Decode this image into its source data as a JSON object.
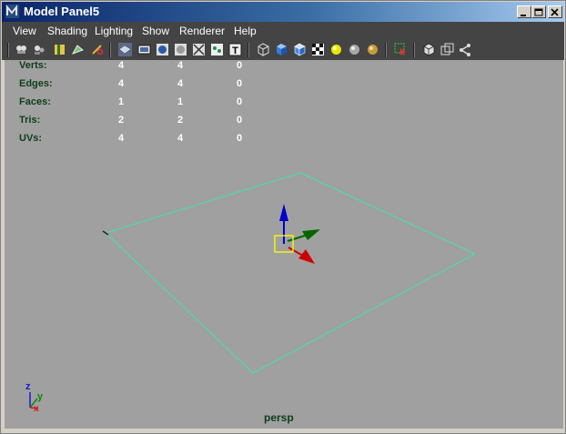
{
  "window": {
    "title": "Model Panel5",
    "controls": [
      "minimize",
      "maximize",
      "close"
    ]
  },
  "menu": [
    "View",
    "Shading",
    "Lighting",
    "Show",
    "Renderer",
    "Help"
  ],
  "toolbar": {
    "icons": [
      "camera-attributes-icon",
      "camera-bookmark-icon",
      "image-plane-icon",
      "two-d-pan-zoom-icon",
      "grease-pencil-icon",
      "grid-icon",
      "film-gate-icon",
      "resolution-gate-icon",
      "gate-mask-icon",
      "field-chart-icon",
      "safe-action-icon",
      "safe-title-icon",
      "wireframe-icon",
      "smooth-shade-icon",
      "wireframe-on-shaded-icon",
      "textured-icon",
      "use-all-lights-icon",
      "shadows-icon",
      "screen-space-ao-icon",
      "isolate-select-icon",
      "xray-icon",
      "xray-active-components-icon",
      "xray-joints-icon"
    ]
  },
  "hud": {
    "rows": [
      {
        "label": "Verts:",
        "v1": "4",
        "v2": "4",
        "v3": "0"
      },
      {
        "label": "Edges:",
        "v1": "4",
        "v2": "4",
        "v3": "0"
      },
      {
        "label": "Faces:",
        "v1": "1",
        "v2": "1",
        "v3": "0"
      },
      {
        "label": "Tris:",
        "v1": "2",
        "v2": "2",
        "v3": "0"
      },
      {
        "label": "UVs:",
        "v1": "4",
        "v2": "4",
        "v3": "0"
      }
    ]
  },
  "axis": {
    "z": "z",
    "y": "y",
    "x": "x"
  },
  "camera": "persp",
  "colors": {
    "plane_wireframe": "#3fe3b0",
    "viewport_bg": "#a0a0a0",
    "hud_label": "#0d3d1a",
    "manip_z": "#0000cc",
    "manip_y": "#006600",
    "manip_x": "#cc0000",
    "manip_center": "#ffff00"
  }
}
